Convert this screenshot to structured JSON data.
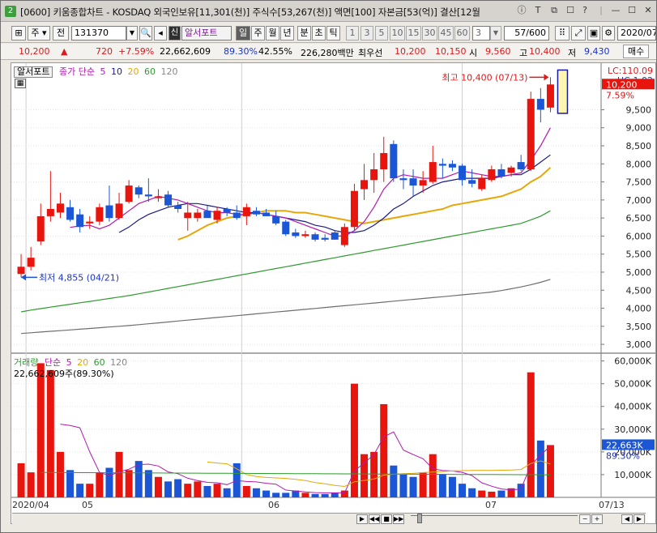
{
  "window": {
    "badge": "2",
    "title": "[0600] 키움종합차트 - KOSDAQ 외국인보유[11,301(천)] 주식수[53,267(천)] 액면[100] 자본금[53(억)] 결산[12월",
    "controls": [
      "ⓘ",
      "T",
      "⧉",
      "☐",
      "?",
      "|",
      "—",
      "☐",
      "✕"
    ]
  },
  "toolbar": {
    "period_label": "주",
    "prev_label": "전",
    "code": "131370",
    "stock_name": "알서포트",
    "sin_label": "신",
    "periods": [
      "일",
      "주",
      "월",
      "년",
      "분",
      "초",
      "틱"
    ],
    "active_period": "일",
    "minute_options": [
      "1",
      "3",
      "5",
      "10",
      "15",
      "30",
      "45",
      "60"
    ],
    "interval_value": "3",
    "page_count": "57/600",
    "date": "2020/07"
  },
  "quote": {
    "price": "10,200",
    "change_arrow": "▲",
    "change": "720",
    "change_pct": "+7.59%",
    "volume": "22,662,609",
    "vol_ratio": "89.30%",
    "turnover": "42.55%",
    "amount": "226,280백만",
    "pref_label": "최우선",
    "ask": "10,200",
    "bid": "10,150",
    "open_label": "시",
    "open": "9,560",
    "high_label": "고",
    "high": "10,400",
    "low_label": "저",
    "low": "9,430",
    "buy_label": "매수"
  },
  "price_panel": {
    "legend_name": "알서포트",
    "ma_label": "종가 단순",
    "ma_periods": [
      "5",
      "10",
      "20",
      "60",
      "120"
    ],
    "ma_colors": [
      "#b01ab0",
      "#1b1b8a",
      "#e6a70a",
      "#2f9a2f",
      "#6e6e6e"
    ],
    "lc_label": "LC:110.09",
    "hc_label": "HC:1.02",
    "last_price_tag": "10,200",
    "last_pct": "7.59%",
    "max_label": "최고 10,400 (07/13)",
    "min_label": "최저 4,855 (04/21)",
    "y_ticks": [
      "9,500",
      "9,000",
      "8,500",
      "8,000",
      "7,500",
      "7,000",
      "6,500",
      "6,000",
      "5,500",
      "5,000",
      "4,500",
      "4,000",
      "3,500",
      "3,000"
    ]
  },
  "volume_panel": {
    "legend_label": "거래량",
    "ma_label": "단순",
    "ma_periods": [
      "5",
      "20",
      "60",
      "120"
    ],
    "info": "22,662,609주(89.30%)",
    "y_ticks": [
      "60,000K",
      "50,000K",
      "40,000K",
      "30,000K",
      "20,000K",
      "10,000K"
    ],
    "last_tag": "22,663K",
    "last_pct": "89.30%"
  },
  "x_axis": {
    "labels": [
      "2020/04",
      "05",
      "06",
      "07"
    ],
    "right_label": "07/13"
  },
  "chart_data": {
    "type": "candlestick",
    "candles": [
      {
        "o": 4950,
        "h": 5500,
        "l": 4855,
        "c": 5150
      },
      {
        "o": 5150,
        "h": 5700,
        "l": 5050,
        "c": 5400
      },
      {
        "o": 5850,
        "h": 6900,
        "l": 5750,
        "c": 6550
      },
      {
        "o": 6550,
        "h": 7800,
        "l": 6400,
        "c": 6750
      },
      {
        "o": 6650,
        "h": 7200,
        "l": 6500,
        "c": 6900
      },
      {
        "o": 6800,
        "h": 7000,
        "l": 6400,
        "c": 6450
      },
      {
        "o": 6600,
        "h": 6750,
        "l": 6100,
        "c": 6250
      },
      {
        "o": 6350,
        "h": 6550,
        "l": 6200,
        "c": 6400
      },
      {
        "o": 6400,
        "h": 6900,
        "l": 6300,
        "c": 6800
      },
      {
        "o": 6850,
        "h": 7400,
        "l": 6400,
        "c": 6500
      },
      {
        "o": 6500,
        "h": 7200,
        "l": 6450,
        "c": 6900
      },
      {
        "o": 6950,
        "h": 7550,
        "l": 6900,
        "c": 7400
      },
      {
        "o": 7350,
        "h": 7400,
        "l": 7050,
        "c": 7150
      },
      {
        "o": 7150,
        "h": 7600,
        "l": 6950,
        "c": 7100
      },
      {
        "o": 7050,
        "h": 7300,
        "l": 6950,
        "c": 7100
      },
      {
        "o": 7150,
        "h": 7250,
        "l": 6800,
        "c": 6850
      },
      {
        "o": 6850,
        "h": 6950,
        "l": 6650,
        "c": 6750
      },
      {
        "o": 6500,
        "h": 6950,
        "l": 6150,
        "c": 6650
      },
      {
        "o": 6500,
        "h": 6750,
        "l": 6400,
        "c": 6650
      },
      {
        "o": 6700,
        "h": 6850,
        "l": 6550,
        "c": 6500
      },
      {
        "o": 6450,
        "h": 6800,
        "l": 6350,
        "c": 6700
      },
      {
        "o": 6750,
        "h": 6800,
        "l": 6550,
        "c": 6650
      },
      {
        "o": 6650,
        "h": 6850,
        "l": 6450,
        "c": 6500
      },
      {
        "o": 6550,
        "h": 6900,
        "l": 6300,
        "c": 6800
      },
      {
        "o": 6700,
        "h": 6800,
        "l": 6550,
        "c": 6600
      },
      {
        "o": 6650,
        "h": 6750,
        "l": 6550,
        "c": 6550
      },
      {
        "o": 6550,
        "h": 6700,
        "l": 6300,
        "c": 6350
      },
      {
        "o": 6400,
        "h": 6450,
        "l": 6000,
        "c": 6050
      },
      {
        "o": 6100,
        "h": 6200,
        "l": 5950,
        "c": 6000
      },
      {
        "o": 6000,
        "h": 6150,
        "l": 5950,
        "c": 6050
      },
      {
        "o": 6050,
        "h": 6100,
        "l": 5850,
        "c": 5900
      },
      {
        "o": 5950,
        "h": 6050,
        "l": 5850,
        "c": 5900
      },
      {
        "o": 6100,
        "h": 6150,
        "l": 5900,
        "c": 5900
      },
      {
        "o": 5750,
        "h": 6350,
        "l": 5700,
        "c": 6250
      },
      {
        "o": 6250,
        "h": 7450,
        "l": 6150,
        "c": 7250
      },
      {
        "o": 7300,
        "h": 8000,
        "l": 7000,
        "c": 7550
      },
      {
        "o": 7550,
        "h": 8300,
        "l": 7200,
        "c": 7850
      },
      {
        "o": 7850,
        "h": 8750,
        "l": 7500,
        "c": 8300
      },
      {
        "o": 8550,
        "h": 8650,
        "l": 7500,
        "c": 7600
      },
      {
        "o": 7600,
        "h": 7850,
        "l": 7300,
        "c": 7550
      },
      {
        "o": 7600,
        "h": 7850,
        "l": 7100,
        "c": 7400
      },
      {
        "o": 7400,
        "h": 7800,
        "l": 7200,
        "c": 7550
      },
      {
        "o": 7500,
        "h": 8500,
        "l": 7450,
        "c": 8050
      },
      {
        "o": 8000,
        "h": 8150,
        "l": 7600,
        "c": 7950
      },
      {
        "o": 8000,
        "h": 8100,
        "l": 7800,
        "c": 7900
      },
      {
        "o": 7950,
        "h": 8000,
        "l": 7400,
        "c": 7550
      },
      {
        "o": 7550,
        "h": 7850,
        "l": 7350,
        "c": 7450
      },
      {
        "o": 7300,
        "h": 7700,
        "l": 7250,
        "c": 7600
      },
      {
        "o": 7550,
        "h": 7950,
        "l": 7500,
        "c": 7850
      },
      {
        "o": 7850,
        "h": 8000,
        "l": 7600,
        "c": 7650
      },
      {
        "o": 7750,
        "h": 7950,
        "l": 7650,
        "c": 7900
      },
      {
        "o": 8050,
        "h": 8250,
        "l": 7800,
        "c": 7850
      },
      {
        "o": 7850,
        "h": 10000,
        "l": 7800,
        "c": 9800
      },
      {
        "o": 9800,
        "h": 10100,
        "l": 9150,
        "c": 9500
      },
      {
        "o": 9560,
        "h": 10400,
        "l": 9430,
        "c": 10200
      }
    ],
    "volume_k": [
      15000,
      11000,
      59000,
      56000,
      20000,
      12000,
      6000,
      6000,
      11000,
      13000,
      20000,
      12000,
      16000,
      12000,
      9000,
      7000,
      8000,
      6000,
      7000,
      5000,
      6000,
      4000,
      15000,
      5000,
      4000,
      3000,
      2000,
      2000,
      3000,
      2000,
      1500,
      1500,
      2000,
      3000,
      50000,
      19000,
      20000,
      41000,
      14000,
      10000,
      9000,
      11000,
      19000,
      10000,
      9000,
      6000,
      4000,
      3000,
      2500,
      3000,
      4000,
      6000,
      55000,
      25000,
      23000
    ],
    "ma5": [
      null,
      null,
      null,
      null,
      null,
      6240,
      6280,
      6300,
      6200,
      6300,
      6500,
      6700,
      6900,
      7000,
      7100,
      7050,
      7000,
      6900,
      6800,
      6700,
      6650,
      6650,
      6600,
      6600,
      6650,
      6600,
      6550,
      6500,
      6400,
      6300,
      6200,
      6100,
      6000,
      6000,
      6150,
      6400,
      6800,
      7300,
      7600,
      7700,
      7650,
      7600,
      7600,
      7600,
      7700,
      7800,
      7750,
      7700,
      7650,
      7650,
      7700,
      7750,
      8100,
      8500,
      9000
    ],
    "ma10": [
      null,
      null,
      null,
      null,
      null,
      null,
      null,
      null,
      null,
      null,
      6100,
      6250,
      6450,
      6600,
      6700,
      6800,
      6850,
      6900,
      6900,
      6850,
      6800,
      6750,
      6700,
      6650,
      6650,
      6600,
      6550,
      6500,
      6450,
      6400,
      6300,
      6250,
      6150,
      6100,
      6100,
      6150,
      6300,
      6500,
      6750,
      6900,
      7100,
      7250,
      7400,
      7500,
      7550,
      7600,
      7600,
      7600,
      7600,
      7650,
      7700,
      7700,
      7850,
      8050,
      8250
    ],
    "ma20": [
      null,
      null,
      null,
      null,
      null,
      null,
      null,
      null,
      null,
      null,
      null,
      null,
      null,
      null,
      null,
      null,
      5900,
      6000,
      6150,
      6300,
      6400,
      6500,
      6550,
      6600,
      6650,
      6700,
      6700,
      6700,
      6650,
      6650,
      6600,
      6550,
      6500,
      6450,
      6400,
      6350,
      6400,
      6450,
      6500,
      6550,
      6600,
      6650,
      6700,
      6750,
      6850,
      6900,
      6950,
      7000,
      7050,
      7100,
      7200,
      7300,
      7500,
      7650,
      7900
    ],
    "ma60": [
      3900,
      3950,
      3990,
      4030,
      4070,
      4110,
      4150,
      4190,
      4230,
      4270,
      4310,
      4350,
      4400,
      4450,
      4500,
      4550,
      4600,
      4650,
      4700,
      4750,
      4800,
      4850,
      4900,
      4950,
      5000,
      5050,
      5100,
      5150,
      5200,
      5250,
      5300,
      5350,
      5400,
      5450,
      5500,
      5550,
      5600,
      5650,
      5700,
      5750,
      5800,
      5850,
      5900,
      5950,
      6000,
      6050,
      6100,
      6150,
      6200,
      6250,
      6300,
      6350,
      6450,
      6550,
      6700
    ],
    "ma120": [
      3300,
      3320,
      3340,
      3360,
      3380,
      3400,
      3420,
      3440,
      3460,
      3480,
      3500,
      3520,
      3545,
      3570,
      3595,
      3620,
      3645,
      3670,
      3695,
      3720,
      3745,
      3770,
      3795,
      3820,
      3845,
      3870,
      3895,
      3920,
      3945,
      3970,
      3995,
      4020,
      4045,
      4070,
      4095,
      4120,
      4145,
      4170,
      4195,
      4220,
      4245,
      4270,
      4295,
      4320,
      4345,
      4370,
      4395,
      4420,
      4450,
      4490,
      4540,
      4590,
      4650,
      4720,
      4800
    ],
    "y_range": [
      2800,
      10700
    ],
    "vol_range_k": [
      0,
      62000
    ]
  }
}
